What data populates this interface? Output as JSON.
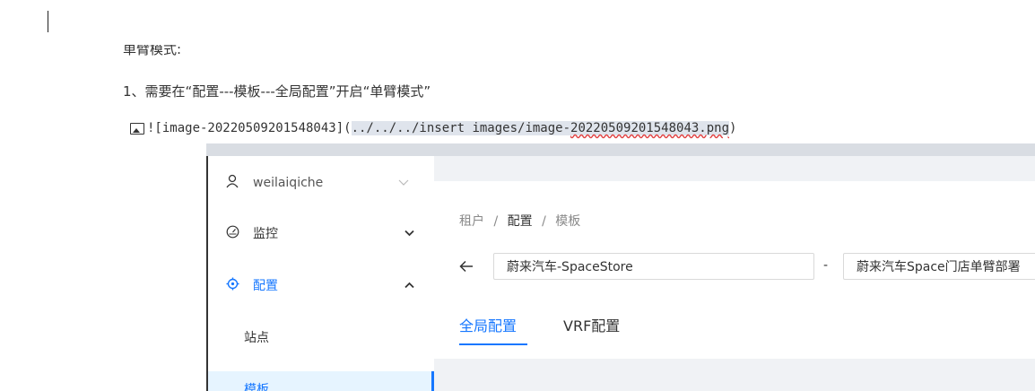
{
  "document": {
    "cut_heading": "单臂模式:",
    "step1": "1、需要在“配置---模板---全局配置”开启“单臂模式”",
    "md_prefix": "![image-20220509201548043](",
    "md_path_a": "../../../insert images/image-",
    "md_path_b": "20220509201548043.png",
    "md_suffix": ")"
  },
  "embedded": {
    "user": "weilaiqiche",
    "sidebar": {
      "monitor": "监控",
      "config": "配置",
      "site": "站点",
      "template": "模板"
    },
    "breadcrumb": {
      "tenant": "租户",
      "sep": "/",
      "config": "配置",
      "template": "模板"
    },
    "tenant_select": "蔚来汽车-SpaceStore",
    "store_select": "蔚来汽车Space门店单臂部署",
    "dash": "-",
    "tabs": [
      "全局配置",
      "VRF配置"
    ],
    "colors": {
      "accent": "#1677ff",
      "active_bg": "#e6f4ff"
    },
    "icons": {
      "user": "user-icon",
      "monitor": "dashboard-icon",
      "config": "target-icon",
      "back": "arrow-left-icon"
    }
  }
}
